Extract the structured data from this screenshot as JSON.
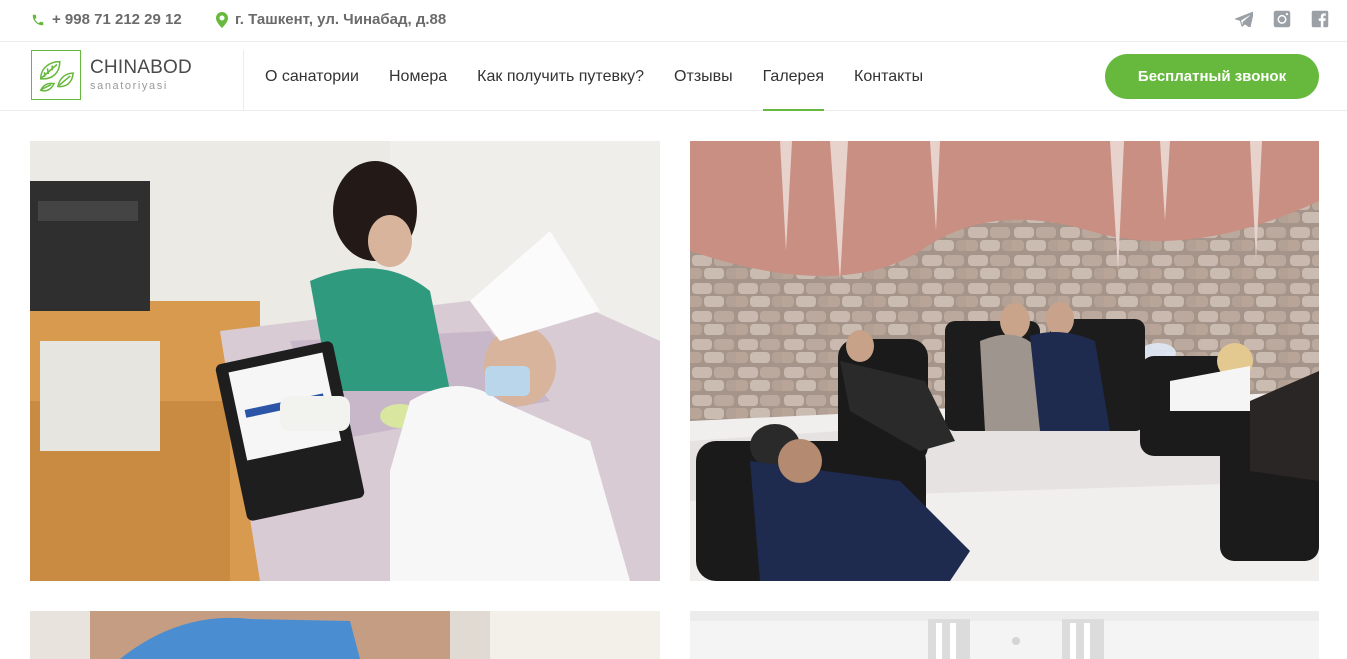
{
  "topbar": {
    "phone": "+ 998 71 212 29 12",
    "address": "г. Ташкент, ул. Чинабад, д.88",
    "socials": [
      "telegram-icon",
      "instagram-icon",
      "facebook-icon"
    ]
  },
  "logo": {
    "name": "CHINABOD",
    "subtitle": "sanatoriyasi"
  },
  "nav": {
    "items": [
      "О санатории",
      "Номера",
      "Как получить путевку?",
      "Отзывы",
      "Галерея",
      "Контакты"
    ],
    "active_index": 4
  },
  "cta_label": "Бесплатный звонок",
  "colors": {
    "accent": "#67b93e",
    "text": "#333333",
    "muted": "#6b6b6b",
    "divider": "#ececec"
  },
  "gallery": {
    "photos": [
      {
        "subject": "medical-examination-photo"
      },
      {
        "subject": "salt-cave-therapy-photo"
      },
      {
        "subject": "doctor-photo"
      },
      {
        "subject": "hall-ceiling-lights-photo"
      }
    ]
  }
}
